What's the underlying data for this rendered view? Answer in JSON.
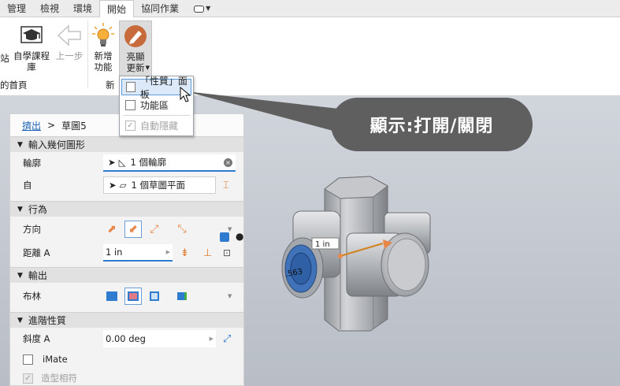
{
  "tabs": [
    "管理",
    "檢視",
    "環境",
    "開始",
    "協同作業"
  ],
  "active_tab": "開始",
  "ribbon": {
    "truncated_left": "站",
    "tutorial_label": "自學課程\n庫",
    "back_label": "上一步",
    "new_features_label": "新增\n功能",
    "highlights_label": "亮顯\n更新",
    "group_home_label": "的首頁",
    "group_new_label": "新"
  },
  "dropdown": {
    "items": [
      {
        "label": "「性質」面板",
        "checked": false,
        "highlighted": true,
        "enabled": true
      },
      {
        "label": "功能區",
        "checked": false,
        "highlighted": false,
        "enabled": true
      },
      {
        "label": "自動隱藏",
        "checked": true,
        "highlighted": false,
        "enabled": false
      }
    ]
  },
  "callout": {
    "text": "顯示:打開/關閉"
  },
  "panel": {
    "breadcrumb_link": "擠出",
    "breadcrumb_sep": ">",
    "breadcrumb_current": "草圖5",
    "sections": {
      "input_geometry": "輸入幾何圖形",
      "behavior": "行為",
      "output": "輸出",
      "advanced": "進階性質"
    },
    "profile_label": "輪廓",
    "profile_value": "1 個輪廓",
    "from_label": "自",
    "from_value": "1 個草圖平面",
    "direction_label": "方向",
    "distance_label": "距離 A",
    "distance_value": "1 in",
    "boolean_label": "布林",
    "taper_label": "斜度 A",
    "taper_value": "0.00 deg",
    "imate_label": "iMate",
    "match_shape_label": "造型相符"
  },
  "viewport": {
    "dimension_label": "1 in",
    "diameter_label": ".563"
  },
  "colors": {
    "accent": "#2f7bd0",
    "callout_bg": "#5f5f5f",
    "orange": "#e8874a"
  }
}
